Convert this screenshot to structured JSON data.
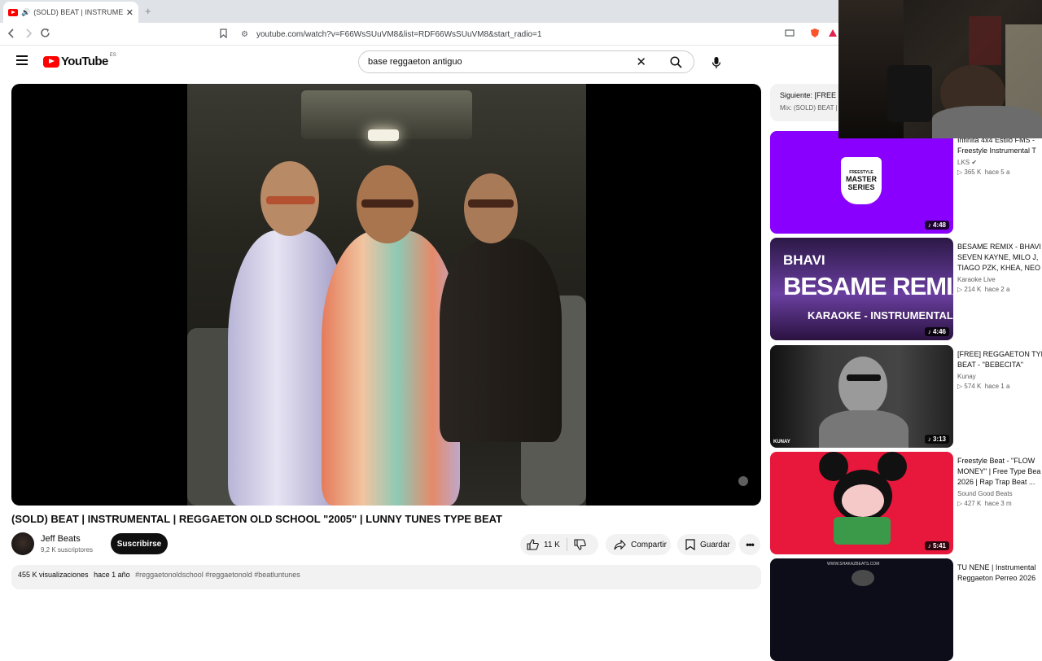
{
  "browser": {
    "tab_title": "(SOLD) BEAT | INSTRUMENTA",
    "url": "youtube.com/watch?v=F66WsSUuVM8&list=RDF66WsSUuVM8&start_radio=1"
  },
  "header": {
    "logo_text": "YouTube",
    "region": "ES",
    "search_value": "base reggaeton antiguo"
  },
  "video": {
    "title": "(SOLD) BEAT | INSTRUMENTAL | REGGAETON OLD SCHOOL \"2005\" | LUNNY TUNES TYPE BEAT",
    "channel": "Jeff Beats",
    "subscribers": "9,2 K suscriptores",
    "subscribe_label": "Suscribirse",
    "likes": "11 K",
    "share_label": "Compartir",
    "save_label": "Guardar",
    "views": "455 K visualizaciones",
    "age": "hace 1 año",
    "hashtags": "#reggaetonoldschool #reggaetonold #beatluntunes"
  },
  "up_next": {
    "line1": "Siguiente: [FREE",
    "line2": "Mix: (SOLD) BEAT |"
  },
  "recommendations": [
    {
      "title_lines": [
        "Infinita 4x4 Estilo FMS -",
        "Freestyle Instrumental T"
      ],
      "channel": "LKS",
      "views": "365 K",
      "age": "hace 5 a",
      "duration": "4:48",
      "thumb_text": [
        "FREESTYLE",
        "MASTER",
        "SERIES"
      ],
      "color": "#8a00ff"
    },
    {
      "title_lines": [
        "BESAME REMIX - BHAVI",
        "SEVEN KAYNE, MILO J,",
        "TIAGO PZK, KHEA, NEO"
      ],
      "channel": "Karaoke Live",
      "views": "214 K",
      "age": "hace 2 a",
      "duration": "4:46",
      "thumb_text": [
        "BHAVI",
        "BESAME REMIX",
        "KARAOKE - INSTRUMENTAL"
      ],
      "color": "#3a1f66"
    },
    {
      "title_lines": [
        "[FREE] REGGAETON TYP",
        "BEAT - \"BEBECITA\""
      ],
      "channel": "Kunay",
      "views": "574 K",
      "age": "hace 1 a",
      "duration": "3:13",
      "thumb_text": [
        "KUNAY"
      ],
      "color": "#2a2a2a"
    },
    {
      "title_lines": [
        "Freestyle Beat - \"FLOW",
        "MONEY\" | Free Type Bea",
        "2026 | Rap Trap Beat ..."
      ],
      "channel": "Sound Good Beats",
      "views": "427 K",
      "age": "hace 3 m",
      "duration": "5:41",
      "thumb_text": [],
      "color": "#e8173c"
    },
    {
      "title_lines": [
        "TU NENE | Instrumental",
        "Reggaeton Perreo 2026"
      ],
      "channel": "",
      "views": "",
      "age": "",
      "duration": "",
      "thumb_text": [
        "WWW.SHAKAZBEATS.COM"
      ],
      "color": "#0d0d1a"
    }
  ]
}
